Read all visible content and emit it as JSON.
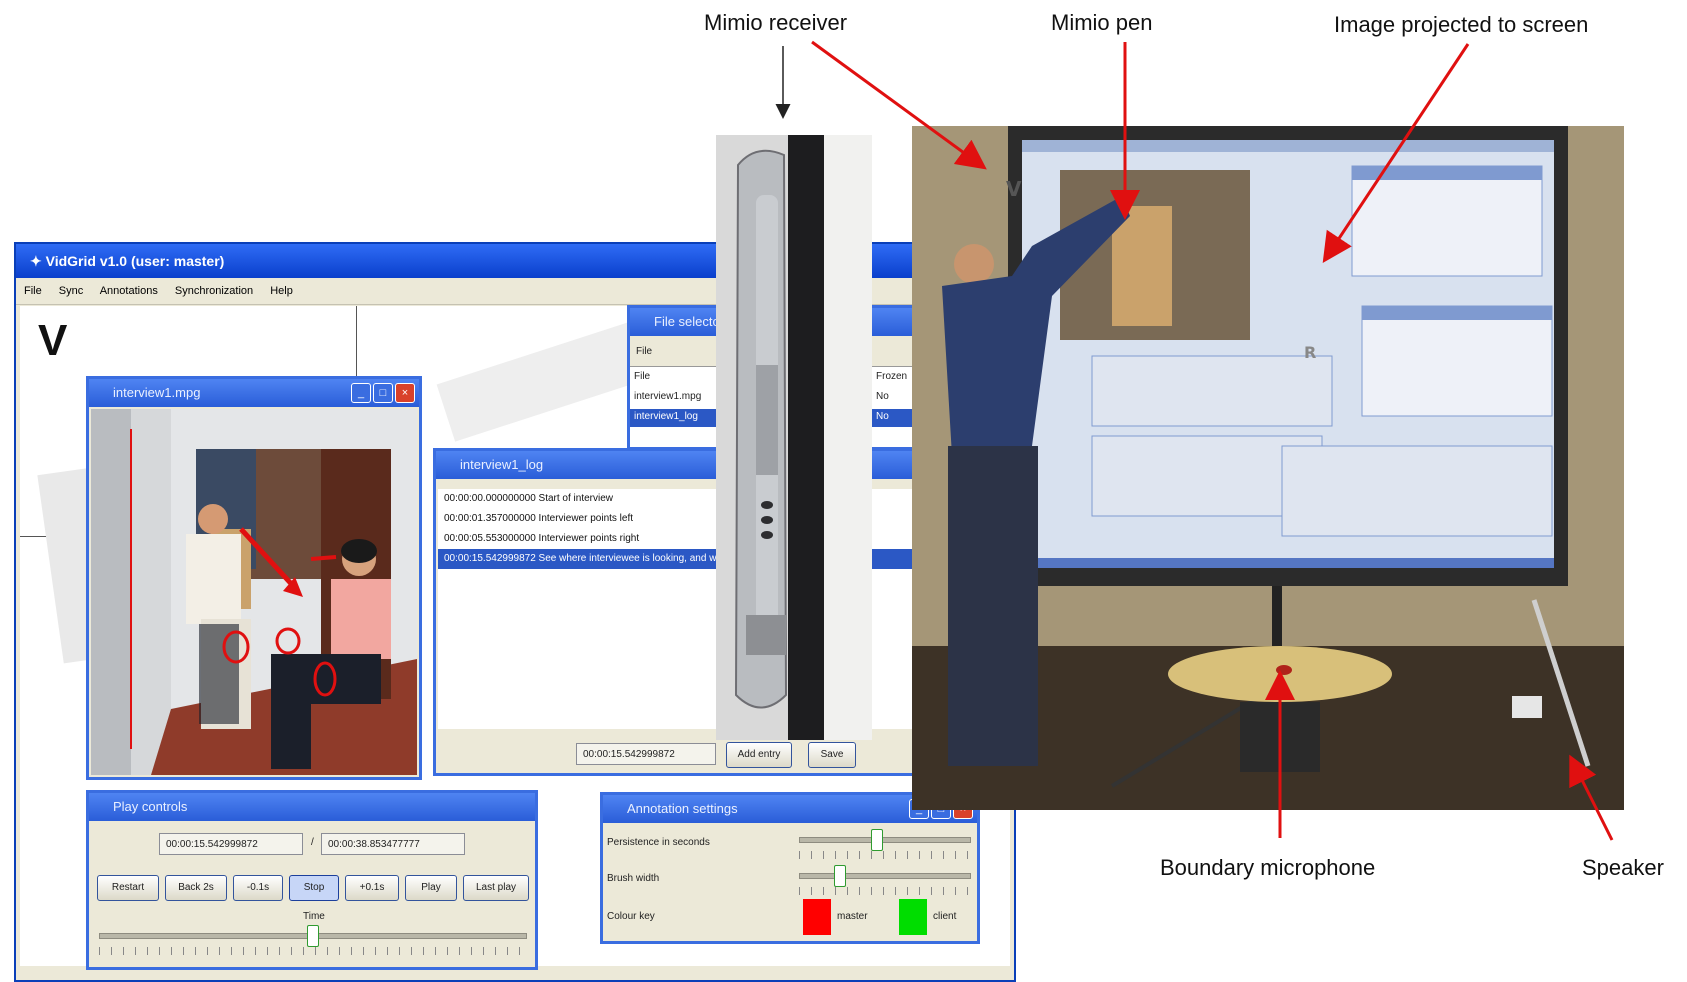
{
  "callouts": {
    "mimio_receiver": "Mimio receiver",
    "mimio_pen": "Mimio pen",
    "image_projected": "Image projected to screen",
    "boundary_microphone": "Boundary microphone",
    "speaker": "Speaker"
  },
  "app": {
    "title": "VidGrid v1.0 (user: master)",
    "menu": [
      "File",
      "Sync",
      "Annotations",
      "Synchronization",
      "Help"
    ],
    "canvas_letter": "V",
    "statusbar": ""
  },
  "video_window": {
    "title": "interview1.mpg"
  },
  "file_selector": {
    "title": "File selector",
    "menu_label": "File",
    "col_file": "File",
    "col_frozen": "Frozen",
    "rows": [
      {
        "file": "interview1.mpg",
        "frozen": "No"
      },
      {
        "file": "interview1_log",
        "frozen": "No"
      }
    ]
  },
  "log_window": {
    "title": "interview1_log",
    "entries": [
      "00:00:00.000000000 Start of interview",
      "00:00:01.357000000 Interviewer points left",
      "00:00:05.553000000 Interviewer points right",
      "00:00:15.542999872 See where interviewee is looking, and wh"
    ],
    "time_field": "00:00:15.542999872",
    "add_entry": "Add entry",
    "save": "Save"
  },
  "play_controls": {
    "title": "Play controls",
    "current_time": "00:00:15.542999872",
    "separator": "/",
    "total_time": "00:00:38.853477777",
    "buttons": [
      "Restart",
      "Back 2s",
      "-0.1s",
      "Stop",
      "+0.1s",
      "Play",
      "Last play"
    ],
    "active_button_index": 3,
    "time_label": "Time",
    "time_position": 0.5
  },
  "annotation_settings": {
    "title": "Annotation settings",
    "persistence_label": "Persistence in seconds",
    "brush_label": "Brush width",
    "colour_label": "Colour key",
    "persistence_position": 0.45,
    "brush_position": 0.22,
    "colour_1_name": "master",
    "colour_1": "#ff0000",
    "colour_2_name": "client",
    "colour_2": "#00dd00"
  },
  "photo": {
    "screen_letter_v": "V",
    "screen_letter_r": "R"
  },
  "colors": {
    "xp_blue": "#0a3fcc",
    "arrow_red": "#e01010"
  }
}
